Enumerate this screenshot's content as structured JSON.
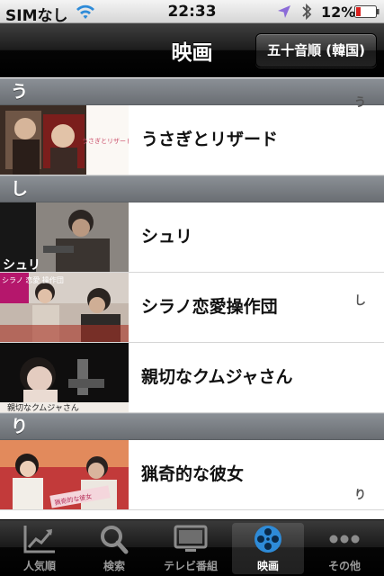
{
  "status_bar": {
    "carrier": "SIMなし",
    "time": "22:33",
    "battery": "12%"
  },
  "nav": {
    "title": "映画",
    "sort_button": "五十音順 (韓国)"
  },
  "sections": [
    {
      "header": "う",
      "index": "う",
      "rows": [
        {
          "title": "うさぎとリザード",
          "poster_text": "うさぎとリザード"
        }
      ]
    },
    {
      "header": "し",
      "index": "し",
      "rows": [
        {
          "title": "シュリ",
          "poster_text": "シュリ"
        },
        {
          "title": "シラノ恋愛操作団",
          "poster_text": "シラノ 恋愛 操作団"
        },
        {
          "title": "親切なクムジャさん",
          "poster_text": "親切なクムジャさん"
        }
      ]
    },
    {
      "header": "り",
      "index": "り",
      "rows": [
        {
          "title": "猟奇的な彼女",
          "poster_text": "猟奇的な彼女"
        }
      ]
    }
  ],
  "tabs": [
    {
      "label": "人気順",
      "icon": "chart-icon",
      "active": false
    },
    {
      "label": "検索",
      "icon": "search-icon",
      "active": false
    },
    {
      "label": "テレビ番組",
      "icon": "tv-icon",
      "active": false
    },
    {
      "label": "映画",
      "icon": "film-reel-icon",
      "active": true
    },
    {
      "label": "その他",
      "icon": "more-icon",
      "active": false
    }
  ],
  "colors": {
    "accent_blue": "#2e8bd8",
    "location_purple": "#8b6bd8",
    "battery_red": "#d9201e"
  }
}
